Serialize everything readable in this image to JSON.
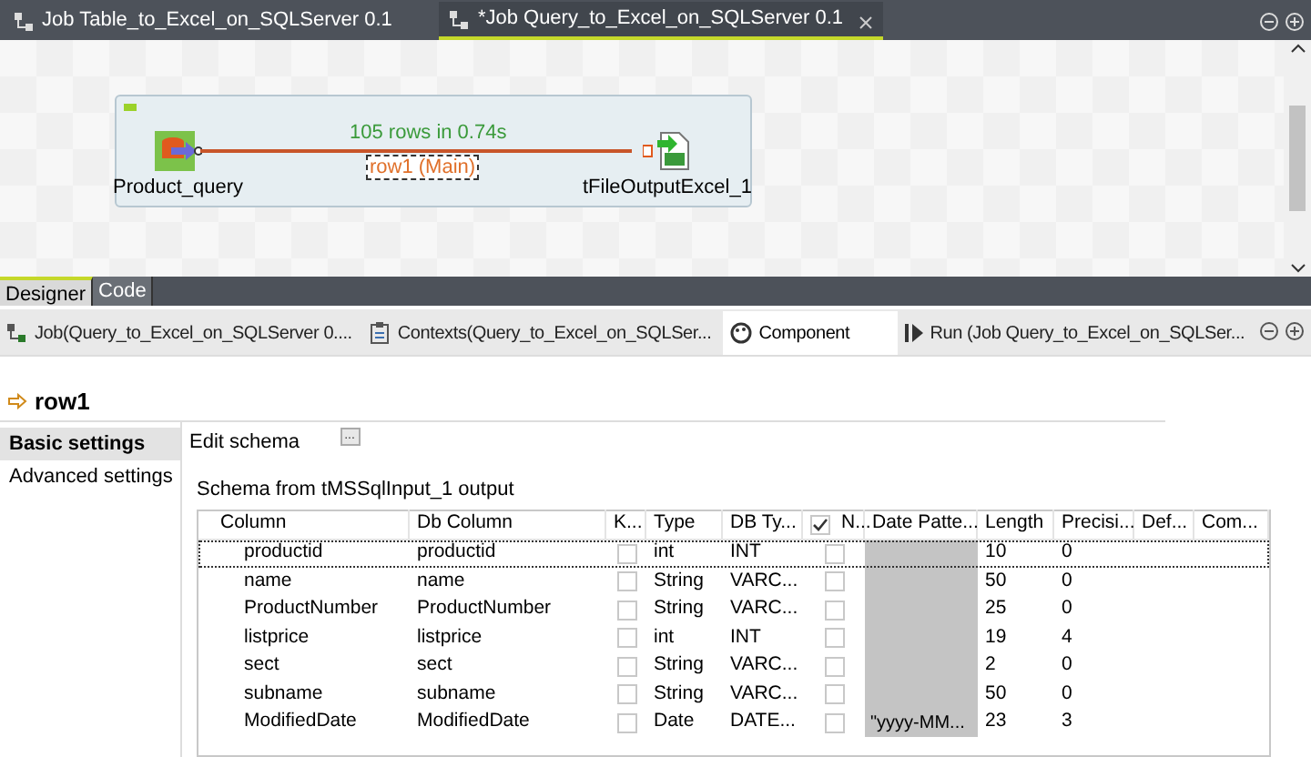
{
  "editor_tabs": [
    {
      "label": "Job Table_to_Excel_on_SQLServer 0.1",
      "selected": false,
      "closable": false
    },
    {
      "label": "*Job Query_to_Excel_on_SQLServer 0.1",
      "selected": true,
      "closable": true
    }
  ],
  "canvas": {
    "nodes": [
      {
        "kind": "db",
        "label": "Product_query"
      },
      {
        "kind": "excel",
        "label": "tFileOutputExcel_1"
      }
    ],
    "link_stats": "105 rows in 0.74s",
    "link_label": "row1 (Main)"
  },
  "view_tabs": [
    {
      "label": "Designer",
      "selected": true
    },
    {
      "label": "Code",
      "selected": false
    }
  ],
  "panel_tabs": [
    {
      "kind": "job",
      "label": "Job(Query_to_Excel_on_SQLServer 0....",
      "selected": false
    },
    {
      "kind": "contexts",
      "label": "Contexts(Query_to_Excel_on_SQLSer...",
      "selected": false
    },
    {
      "kind": "component",
      "label": "Component",
      "selected": true
    },
    {
      "kind": "run",
      "label": "Run (Job Query_to_Excel_on_SQLSer...",
      "selected": false
    }
  ],
  "component_title": "row1",
  "settings_nav": [
    {
      "label": "Basic settings",
      "selected": true
    },
    {
      "label": "Advanced settings",
      "selected": false
    }
  ],
  "edit_schema_label": "Edit schema",
  "edit_schema_button": "...",
  "schema_title": "Schema from tMSSqlInput_1 output",
  "table": {
    "columns": [
      "Column",
      "Db Column",
      "K...",
      "Type",
      "DB Ty...",
      "N...",
      "Date Patte...",
      "Length",
      "Precisi...",
      "Def...",
      "Com..."
    ],
    "nullable_header_checked": true,
    "rows": [
      {
        "column": "productid",
        "db_column": "productid",
        "key": false,
        "type": "int",
        "db_type": "INT",
        "nullable": false,
        "date_pattern": "",
        "length": "10",
        "precision": "0",
        "selected": true
      },
      {
        "column": "name",
        "db_column": "name",
        "key": false,
        "type": "String",
        "db_type": "VARC...",
        "nullable": false,
        "date_pattern": "",
        "length": "50",
        "precision": "0",
        "selected": false
      },
      {
        "column": "ProductNumber",
        "db_column": "ProductNumber",
        "key": false,
        "type": "String",
        "db_type": "VARC...",
        "nullable": false,
        "date_pattern": "",
        "length": "25",
        "precision": "0",
        "selected": false
      },
      {
        "column": "listprice",
        "db_column": "listprice",
        "key": false,
        "type": "int",
        "db_type": "INT",
        "nullable": false,
        "date_pattern": "",
        "length": "19",
        "precision": "4",
        "selected": false
      },
      {
        "column": "sect",
        "db_column": "sect",
        "key": false,
        "type": "String",
        "db_type": "VARC...",
        "nullable": false,
        "date_pattern": "",
        "length": "2",
        "precision": "0",
        "selected": false
      },
      {
        "column": "subname",
        "db_column": "subname",
        "key": false,
        "type": "String",
        "db_type": "VARC...",
        "nullable": false,
        "date_pattern": "",
        "length": "50",
        "precision": "0",
        "selected": false
      },
      {
        "column": "ModifiedDate",
        "db_column": "ModifiedDate",
        "key": false,
        "type": "Date",
        "db_type": "DATE...",
        "nullable": false,
        "date_pattern": "\"yyyy-MM...",
        "length": "23",
        "precision": "3",
        "selected": false
      }
    ]
  }
}
